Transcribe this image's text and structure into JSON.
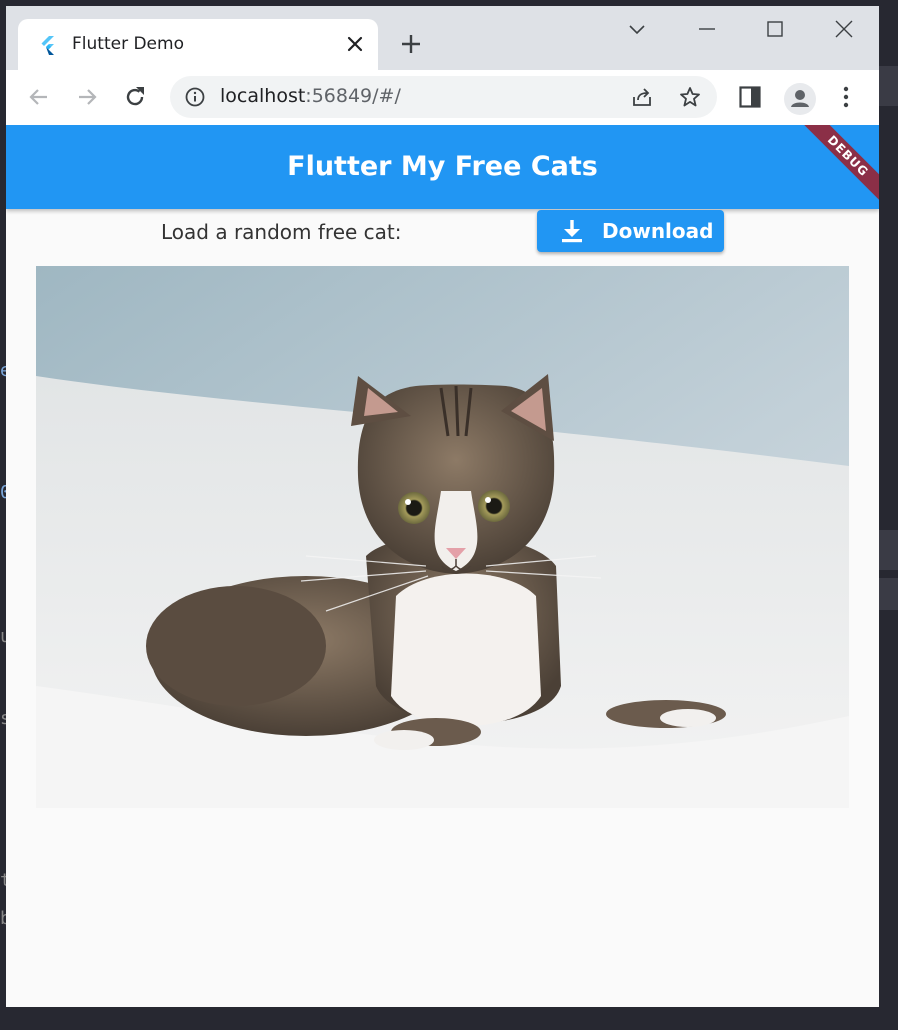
{
  "browser": {
    "tab_title": "Flutter Demo",
    "url_host": "localhost",
    "url_rest": ":56849/#/"
  },
  "icons": {
    "favicon": "flutter-logo-icon",
    "tab_close": "close-icon",
    "new_tab": "plus-icon",
    "tab_search": "chevron-down-icon",
    "minimize": "minimize-icon",
    "maximize": "maximize-icon",
    "close_window": "close-icon",
    "back": "arrow-left-icon",
    "forward": "arrow-right-icon",
    "reload": "reload-icon",
    "site_info": "info-icon",
    "share": "share-icon",
    "bookmark": "star-icon",
    "side_panel": "side-panel-icon",
    "profile": "person-icon",
    "menu": "kebab-menu-icon",
    "download": "download-icon"
  },
  "app": {
    "title": "Flutter My Free Cats",
    "debug_banner": "DEBUG",
    "load_label": "Load a random free cat:",
    "download_label": "Download"
  },
  "colors": {
    "app_bar": "#2196f3",
    "button": "#2196f3",
    "debug_banner": "#8b2f47",
    "page_bg": "#fafafa"
  }
}
